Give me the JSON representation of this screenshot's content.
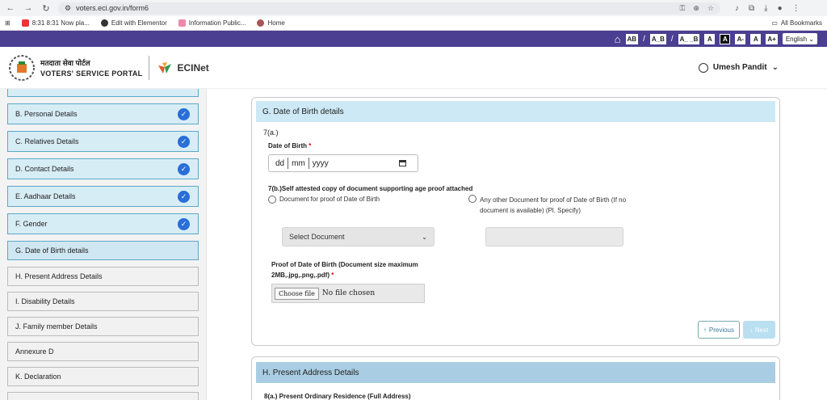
{
  "browser": {
    "url": "voters.eci.gov.in/form6",
    "bookmarks": [
      "8:31 8:31 Now pla...",
      "Edit with Elementor",
      "Information Public...",
      "Home"
    ],
    "all_bookmarks": "All Bookmarks"
  },
  "accessibility": {
    "buttons": [
      "AB",
      "A_B",
      "A_ _B",
      "A",
      "A",
      "A-",
      "A",
      "A+"
    ],
    "language": "English"
  },
  "header": {
    "portal_hindi": "मतदाता सेवा पोर्टल",
    "portal_english": "VOTERS' SERVICE PORTAL",
    "ecinet": "ECINet",
    "user_name": "Umesh Pandit"
  },
  "sidebar": {
    "items": [
      {
        "label": "B. Personal Details",
        "done": true
      },
      {
        "label": "C. Relatives Details",
        "done": true
      },
      {
        "label": "D. Contact Details",
        "done": true
      },
      {
        "label": "E. Aadhaar Details",
        "done": true
      },
      {
        "label": "F. Gender",
        "done": true
      },
      {
        "label": "G. Date of Birth details",
        "done": false
      },
      {
        "label": "H. Present Address Details",
        "done": false
      },
      {
        "label": "I. Disability Details",
        "done": false
      },
      {
        "label": "J. Family member Details",
        "done": false
      },
      {
        "label": "Annexure D",
        "done": false
      },
      {
        "label": "K. Declaration",
        "done": false
      }
    ]
  },
  "dob_section": {
    "title": "G. Date of Birth details",
    "number": "7(a.)",
    "dob_label": "Date of Birth",
    "required_mark": "*",
    "date_dd": "dd",
    "date_mm": "mm",
    "date_yyyy": "yyyy",
    "proof_title": "7(b.)Self attested copy of document supporting age proof attached",
    "radio_1": "Document for proof of Date of Birth",
    "radio_2": "Any other Document for proof of Date of Birth (If no document is available) (Pl. Specify)",
    "select_placeholder": "Select Document",
    "file_label": "Proof of Date of Birth (Document size maximum 2MB,.jpg,.png,.pdf)",
    "file_button": "Choose file",
    "file_status": "No file chosen",
    "previous": "Previous",
    "next": "Next"
  },
  "address_section": {
    "title": "H. Present Address Details",
    "subtitle": "8(a.) Present Ordinary Residence (Full Address)"
  }
}
